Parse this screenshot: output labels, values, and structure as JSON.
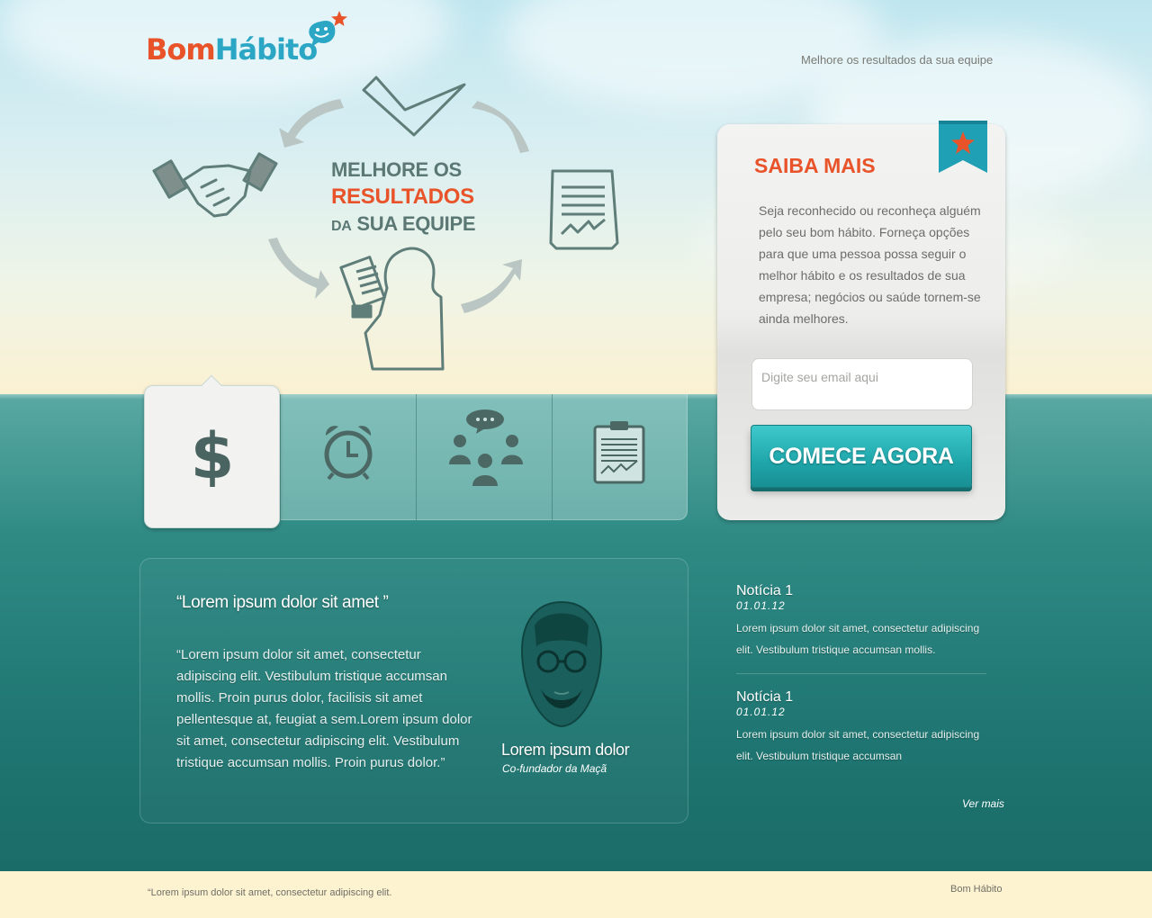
{
  "brand": {
    "part1": "Bom",
    "part2": "Hábito"
  },
  "header": {
    "tagline": "Melhore os resultados da sua equipe"
  },
  "hero": {
    "line1": "MELHORE OS",
    "line2": "RESULTADOS",
    "line3_small": "DA",
    "line3": "SUA EQUIPE"
  },
  "tabs": [
    {
      "icon": "dollar-icon",
      "active": true
    },
    {
      "icon": "alarm-clock-icon",
      "active": false
    },
    {
      "icon": "people-chat-icon",
      "active": false
    },
    {
      "icon": "report-clipboard-icon",
      "active": false
    }
  ],
  "panel": {
    "title": "SAIBA MAIS",
    "text": "Seja reconhecido ou reconheça alguém pelo seu bom hábito. Forneça opções para que uma pessoa possa seguir o melhor hábito e os resultados de sua empresa; negócios ou saúde tornem-se ainda melhores.",
    "email_placeholder": "Digite seu email aqui",
    "email_value": "",
    "cta_label": "COMECE AGORA"
  },
  "testimonial": {
    "title": "“Lorem ipsum dolor sit amet ”",
    "text": "“Lorem ipsum dolor sit amet, consectetur adipiscing elit. Vestibulum tristique accumsan mollis. Proin purus dolor, facilisis sit amet pellentesque at, feugiat a sem.Lorem ipsum dolor sit amet, consectetur adipiscing elit. Vestibulum tristique accumsan mollis. Proin purus dolor.”",
    "name": "Lorem ipsum dolor",
    "role": "Co-fundador da Maçã"
  },
  "news": [
    {
      "title": "Notícia 1",
      "date": "01.01.12",
      "text": "Lorem ipsum dolor sit amet, consectetur adipiscing elit. Vestibulum tristique accumsan mollis."
    },
    {
      "title": "Notícia 1",
      "date": "01.01.12",
      "text": "Lorem ipsum dolor sit amet, consectetur adipiscing elit. Vestibulum tristique accumsan"
    }
  ],
  "news_more": "Ver mais",
  "footer": {
    "quote": "“Lorem ipsum dolor sit amet, consectetur adipiscing elit.",
    "brand": "Bom Hábito"
  },
  "colors": {
    "accent_orange": "#e8532a",
    "brand_blue": "#2ba6c4",
    "teal_button": "#1fa6aa",
    "sea": "#1f7672"
  }
}
